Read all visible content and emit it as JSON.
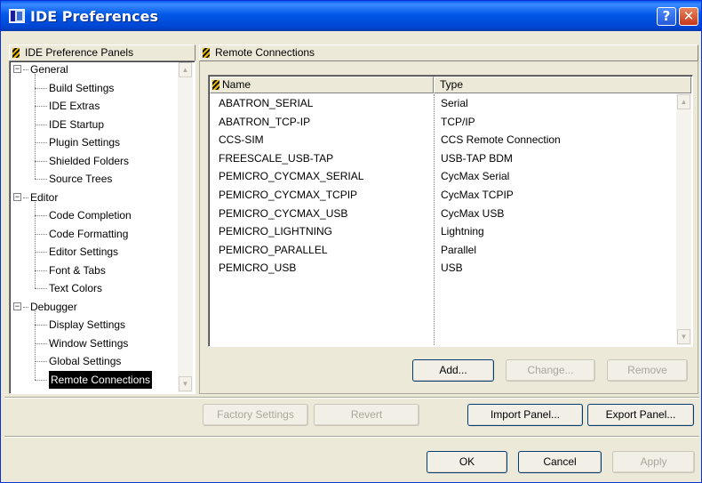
{
  "window": {
    "title": "IDE Preferences",
    "help_glyph": "?",
    "close_glyph": "✕"
  },
  "left_panel": {
    "header": "IDE Preference Panels",
    "groups": [
      {
        "label": "General",
        "expander": "−",
        "items": [
          "Build Settings",
          "IDE Extras",
          "IDE Startup",
          "Plugin Settings",
          "Shielded Folders",
          "Source Trees"
        ]
      },
      {
        "label": "Editor",
        "expander": "−",
        "items": [
          "Code Completion",
          "Code Formatting",
          "Editor Settings",
          "Font & Tabs",
          "Text Colors"
        ]
      },
      {
        "label": "Debugger",
        "expander": "−",
        "items": [
          "Display Settings",
          "Window Settings",
          "Global Settings",
          "Remote Connections"
        ]
      }
    ],
    "selected_item": "Remote Connections"
  },
  "right_panel": {
    "header": "Remote Connections",
    "columns": {
      "name": "Name",
      "type": "Type"
    },
    "rows": [
      {
        "name": "ABATRON_SERIAL",
        "type": "Serial"
      },
      {
        "name": "ABATRON_TCP-IP",
        "type": "TCP/IP"
      },
      {
        "name": "CCS-SIM",
        "type": "CCS Remote Connection"
      },
      {
        "name": "FREESCALE_USB-TAP",
        "type": "USB-TAP BDM"
      },
      {
        "name": "PEMICRO_CYCMAX_SERIAL",
        "type": "CycMax Serial"
      },
      {
        "name": "PEMICRO_CYCMAX_TCPIP",
        "type": "CycMax TCPIP"
      },
      {
        "name": "PEMICRO_CYCMAX_USB",
        "type": "CycMax USB"
      },
      {
        "name": "PEMICRO_LIGHTNING",
        "type": "Lightning"
      },
      {
        "name": "PEMICRO_PARALLEL",
        "type": "Parallel"
      },
      {
        "name": "PEMICRO_USB",
        "type": "USB"
      }
    ],
    "buttons": {
      "add": "Add...",
      "change": "Change...",
      "remove": "Remove"
    }
  },
  "panel_buttons": {
    "factory_settings": "Factory Settings",
    "revert": "Revert",
    "import_panel": "Import Panel...",
    "export_panel": "Export Panel..."
  },
  "dialog_buttons": {
    "ok": "OK",
    "cancel": "Cancel",
    "apply": "Apply"
  },
  "scroll_glyphs": {
    "up": "▲",
    "down": "▼"
  },
  "colors": {
    "titlebar": "#0058e6",
    "selection_bg": "#000000",
    "selection_fg": "#ffffff",
    "dialog_bg": "#ece9d8"
  }
}
